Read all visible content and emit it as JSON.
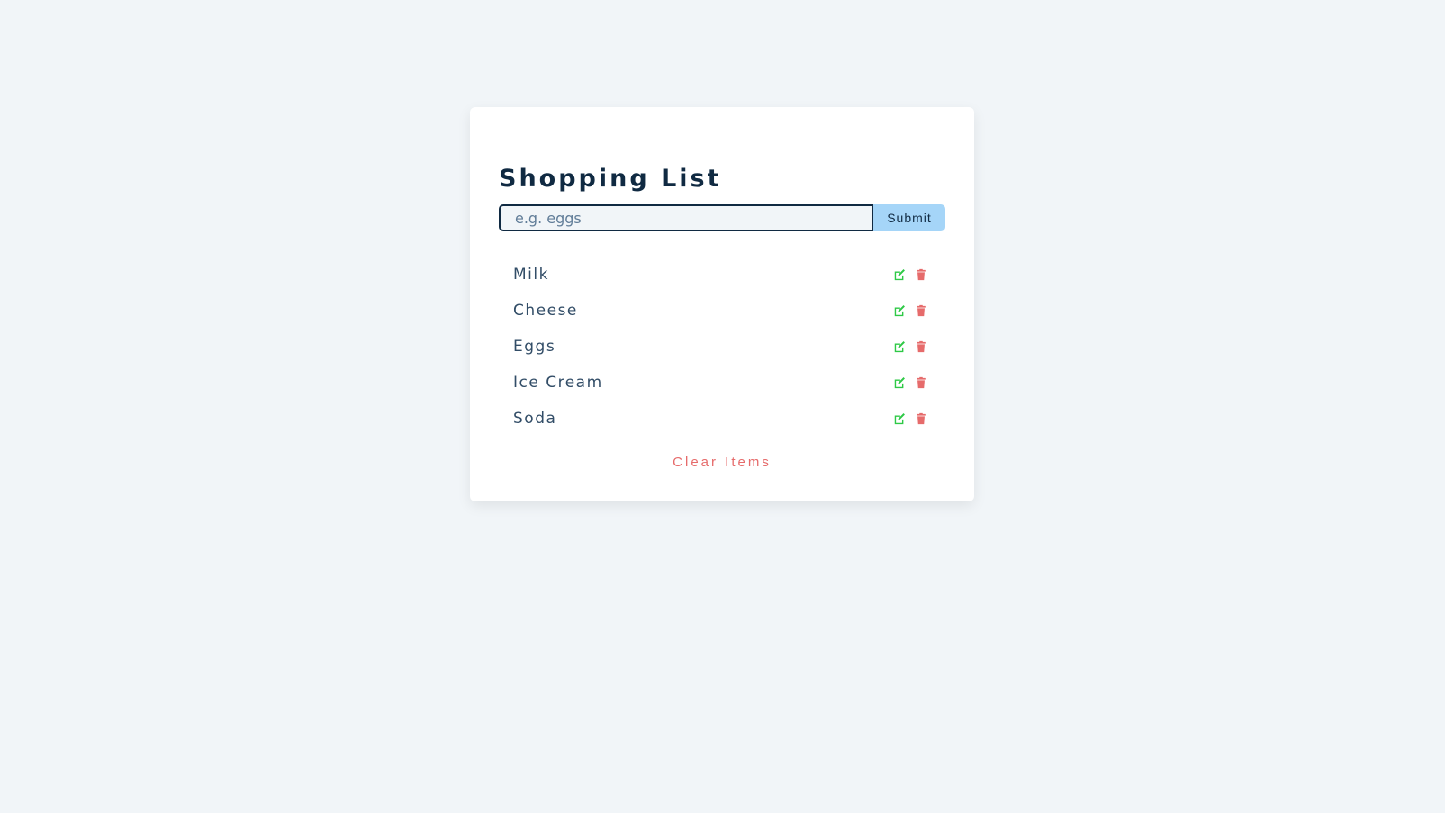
{
  "page": {
    "title": "Shopping List"
  },
  "form": {
    "placeholder": "e.g. eggs",
    "value": "",
    "submit_label": "Submit"
  },
  "items": [
    {
      "name": "Milk",
      "edit_icon": "edit-icon",
      "delete_icon": "trash-icon"
    },
    {
      "name": "Cheese",
      "edit_icon": "edit-icon",
      "delete_icon": "trash-icon"
    },
    {
      "name": "Eggs",
      "edit_icon": "edit-icon",
      "delete_icon": "trash-icon"
    },
    {
      "name": "Ice Cream",
      "edit_icon": "edit-icon",
      "delete_icon": "trash-icon"
    },
    {
      "name": "Soda",
      "edit_icon": "edit-icon",
      "delete_icon": "trash-icon"
    }
  ],
  "clear_label": "Clear Items",
  "colors": {
    "background": "#f1f5f8",
    "card": "#ffffff",
    "title": "#102a42",
    "submit_bg": "#a5d5f8",
    "edit_icon": "#2ec946",
    "delete_icon": "#e66b6b",
    "clear_text": "#e66b6b"
  }
}
